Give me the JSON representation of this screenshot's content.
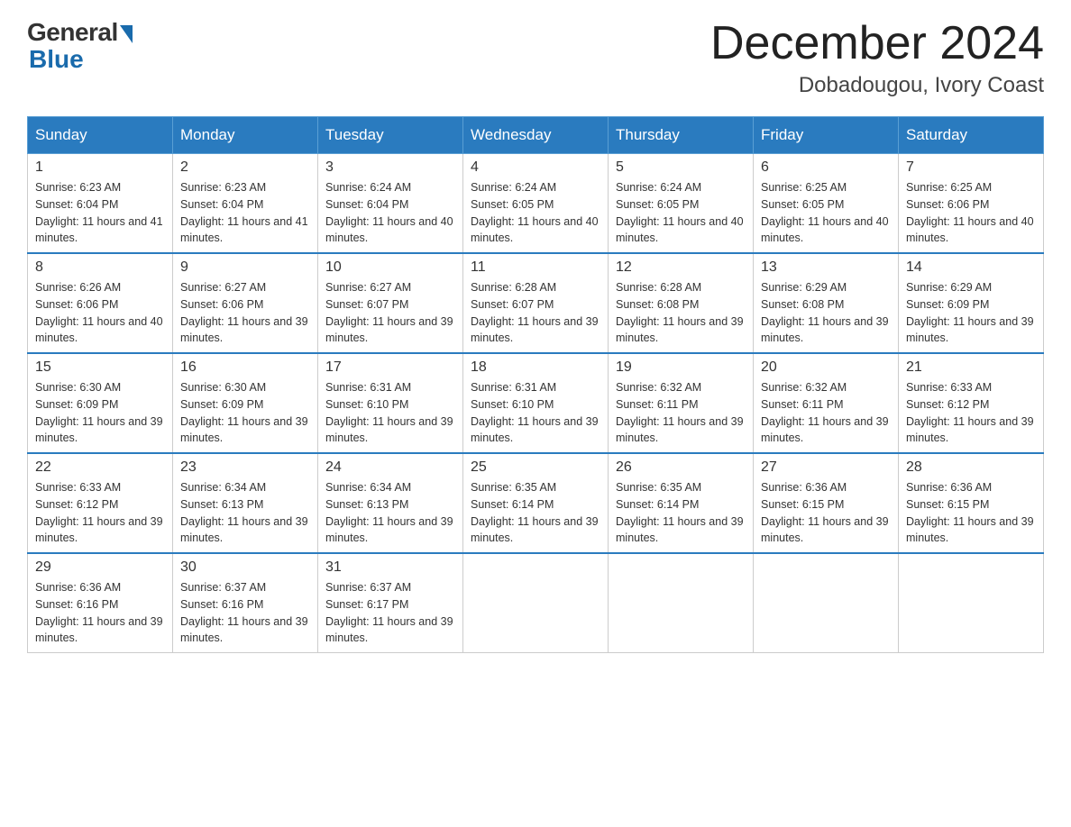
{
  "logo": {
    "general": "General",
    "blue": "Blue"
  },
  "title": {
    "month_year": "December 2024",
    "location": "Dobadougou, Ivory Coast"
  },
  "headers": [
    "Sunday",
    "Monday",
    "Tuesday",
    "Wednesday",
    "Thursday",
    "Friday",
    "Saturday"
  ],
  "weeks": [
    [
      {
        "day": "1",
        "sunrise": "6:23 AM",
        "sunset": "6:04 PM",
        "daylight": "11 hours and 41 minutes."
      },
      {
        "day": "2",
        "sunrise": "6:23 AM",
        "sunset": "6:04 PM",
        "daylight": "11 hours and 41 minutes."
      },
      {
        "day": "3",
        "sunrise": "6:24 AM",
        "sunset": "6:04 PM",
        "daylight": "11 hours and 40 minutes."
      },
      {
        "day": "4",
        "sunrise": "6:24 AM",
        "sunset": "6:05 PM",
        "daylight": "11 hours and 40 minutes."
      },
      {
        "day": "5",
        "sunrise": "6:24 AM",
        "sunset": "6:05 PM",
        "daylight": "11 hours and 40 minutes."
      },
      {
        "day": "6",
        "sunrise": "6:25 AM",
        "sunset": "6:05 PM",
        "daylight": "11 hours and 40 minutes."
      },
      {
        "day": "7",
        "sunrise": "6:25 AM",
        "sunset": "6:06 PM",
        "daylight": "11 hours and 40 minutes."
      }
    ],
    [
      {
        "day": "8",
        "sunrise": "6:26 AM",
        "sunset": "6:06 PM",
        "daylight": "11 hours and 40 minutes."
      },
      {
        "day": "9",
        "sunrise": "6:27 AM",
        "sunset": "6:06 PM",
        "daylight": "11 hours and 39 minutes."
      },
      {
        "day": "10",
        "sunrise": "6:27 AM",
        "sunset": "6:07 PM",
        "daylight": "11 hours and 39 minutes."
      },
      {
        "day": "11",
        "sunrise": "6:28 AM",
        "sunset": "6:07 PM",
        "daylight": "11 hours and 39 minutes."
      },
      {
        "day": "12",
        "sunrise": "6:28 AM",
        "sunset": "6:08 PM",
        "daylight": "11 hours and 39 minutes."
      },
      {
        "day": "13",
        "sunrise": "6:29 AM",
        "sunset": "6:08 PM",
        "daylight": "11 hours and 39 minutes."
      },
      {
        "day": "14",
        "sunrise": "6:29 AM",
        "sunset": "6:09 PM",
        "daylight": "11 hours and 39 minutes."
      }
    ],
    [
      {
        "day": "15",
        "sunrise": "6:30 AM",
        "sunset": "6:09 PM",
        "daylight": "11 hours and 39 minutes."
      },
      {
        "day": "16",
        "sunrise": "6:30 AM",
        "sunset": "6:09 PM",
        "daylight": "11 hours and 39 minutes."
      },
      {
        "day": "17",
        "sunrise": "6:31 AM",
        "sunset": "6:10 PM",
        "daylight": "11 hours and 39 minutes."
      },
      {
        "day": "18",
        "sunrise": "6:31 AM",
        "sunset": "6:10 PM",
        "daylight": "11 hours and 39 minutes."
      },
      {
        "day": "19",
        "sunrise": "6:32 AM",
        "sunset": "6:11 PM",
        "daylight": "11 hours and 39 minutes."
      },
      {
        "day": "20",
        "sunrise": "6:32 AM",
        "sunset": "6:11 PM",
        "daylight": "11 hours and 39 minutes."
      },
      {
        "day": "21",
        "sunrise": "6:33 AM",
        "sunset": "6:12 PM",
        "daylight": "11 hours and 39 minutes."
      }
    ],
    [
      {
        "day": "22",
        "sunrise": "6:33 AM",
        "sunset": "6:12 PM",
        "daylight": "11 hours and 39 minutes."
      },
      {
        "day": "23",
        "sunrise": "6:34 AM",
        "sunset": "6:13 PM",
        "daylight": "11 hours and 39 minutes."
      },
      {
        "day": "24",
        "sunrise": "6:34 AM",
        "sunset": "6:13 PM",
        "daylight": "11 hours and 39 minutes."
      },
      {
        "day": "25",
        "sunrise": "6:35 AM",
        "sunset": "6:14 PM",
        "daylight": "11 hours and 39 minutes."
      },
      {
        "day": "26",
        "sunrise": "6:35 AM",
        "sunset": "6:14 PM",
        "daylight": "11 hours and 39 minutes."
      },
      {
        "day": "27",
        "sunrise": "6:36 AM",
        "sunset": "6:15 PM",
        "daylight": "11 hours and 39 minutes."
      },
      {
        "day": "28",
        "sunrise": "6:36 AM",
        "sunset": "6:15 PM",
        "daylight": "11 hours and 39 minutes."
      }
    ],
    [
      {
        "day": "29",
        "sunrise": "6:36 AM",
        "sunset": "6:16 PM",
        "daylight": "11 hours and 39 minutes."
      },
      {
        "day": "30",
        "sunrise": "6:37 AM",
        "sunset": "6:16 PM",
        "daylight": "11 hours and 39 minutes."
      },
      {
        "day": "31",
        "sunrise": "6:37 AM",
        "sunset": "6:17 PM",
        "daylight": "11 hours and 39 minutes."
      },
      null,
      null,
      null,
      null
    ]
  ]
}
